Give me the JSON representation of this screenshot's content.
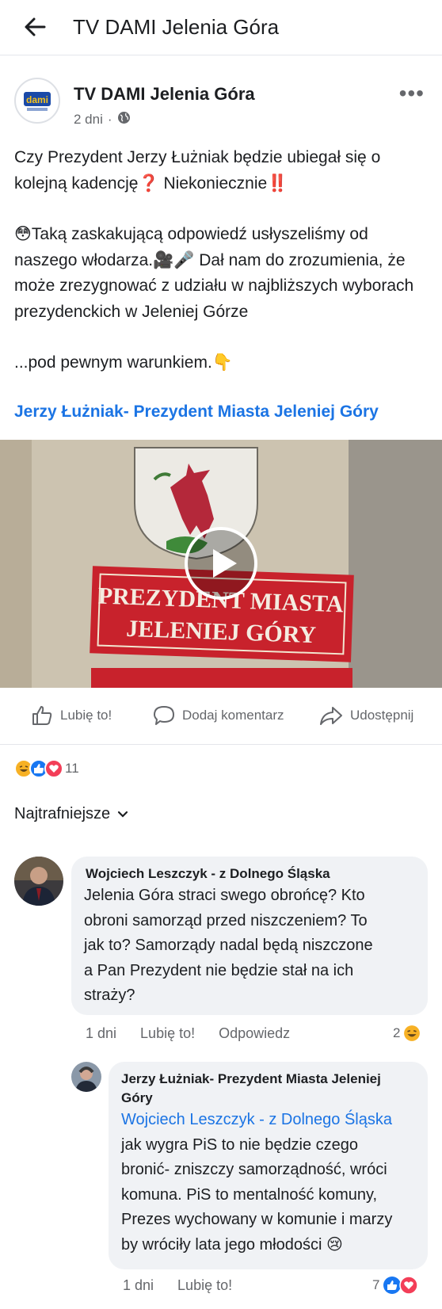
{
  "topbar": {
    "title": "TV DAMI Jelenia Góra",
    "back_icon": "arrow-left-icon"
  },
  "post": {
    "page_name": "TV DAMI Jelenia Góra",
    "time": "2 dni",
    "time_sep": "·",
    "audience_icon": "globe-icon",
    "avatar_text": "dami",
    "text": {
      "l1": "Czy Prezydent Jerzy Łużniak będzie ubiegał się o",
      "l2": "kolejną kadencję",
      "l2_emoji": "❓",
      "l2b": "Niekoniecznie",
      "l2_emoji2": "‼️",
      "l3_emoji": "😳",
      "l3": "Taką zaskakującą odpowiedź usłyszeliśmy od",
      "l4": "naszego włodarza.",
      "l4_emoji": "🎥🎤",
      "l4b": "Dał nam do zrozumienia, że",
      "l5": "może zrezygnować z udziału w najbliższych wyborach",
      "l6": "prezydenckich w Jeleniej Górze",
      "l7": "...pod pewnym warunkiem.",
      "l7_emoji": "👇"
    },
    "link": "Jerzy Łużniak- Prezydent Miasta Jeleniej Góry",
    "video": {
      "sign_line1": "PREZYDENT MIASTA",
      "sign_line2": "JELENIEJ GÓRY"
    },
    "actions": {
      "like": "Lubię to!",
      "comment": "Dodaj komentarz",
      "share": "Udostępnij"
    },
    "reaction_count": "11",
    "sort_label": "Najtrafniejsze"
  },
  "comments": [
    {
      "author": "Wojciech Leszczyk - z Dolnego Śląska",
      "lines": [
        "Jelenia Góra straci swego obrońcę? Kto",
        "obroni samorząd przed niszczeniem? To",
        "jak to? Samorządy nadal będą niszczone",
        "a Pan Prezydent nie będzie stał na ich",
        "straży?"
      ],
      "time": "1 dni",
      "like": "Lubię to!",
      "reply": "Odpowiedz",
      "reaction_count": "2"
    },
    {
      "author_l1": "Jerzy Łużniak- Prezydent Miasta Jeleniej",
      "author_l2": "Góry",
      "mention": "Wojciech Leszczyk - z Dolnego Śląska",
      "lines": [
        "jak wygra PiS to nie będzie czego",
        "bronić- zniszczy samorządność, wróci",
        "komuna. PiS to mentalność komuny,",
        "Prezes wychowany w komunie i marzy",
        "by wróciły lata jego młodości"
      ],
      "emoji": "😢",
      "time": "1 dni",
      "like": "Lubię to!",
      "reaction_count": "7"
    }
  ],
  "colors": {
    "link": "#1b74e4",
    "text": "#1c1e21",
    "muted": "#65676b",
    "bubble": "#f0f2f5"
  }
}
